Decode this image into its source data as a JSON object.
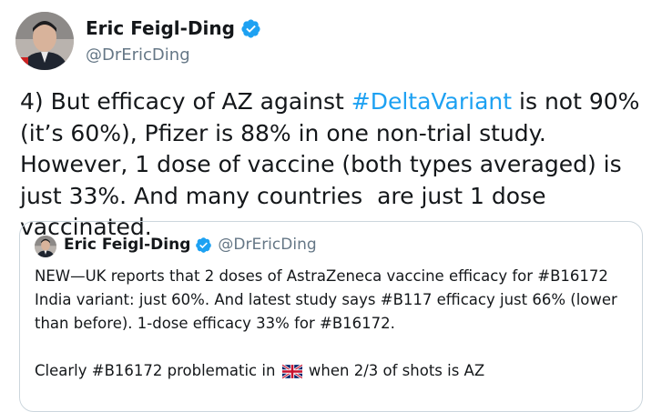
{
  "tweet": {
    "author_name": "Eric Feigl-Ding",
    "author_handle": "@DrEricDing",
    "text_part1": "4) But efficacy of AZ against ",
    "hashtag": "#DeltaVariant",
    "text_part2": " is not 90% (it’s 60%), Pfizer is 88% in one non-trial study. However, 1 dose of vaccine (both types averaged) is just 33%. And many countries  are just 1 dose vaccinated."
  },
  "quote": {
    "author_name": "Eric Feigl-Ding",
    "author_handle": "@DrEricDing",
    "paragraph1": "NEW—UK reports that 2 doses of AstraZeneca vaccine efficacy for #B16172 India variant: just 60%. And latest study says #B117 efficacy just 66% (lower than before). 1-dose efficacy 33% for #B16172.",
    "paragraph2_before_flag": "Clearly #B16172 problematic in ",
    "flag_icon": "uk-flag-icon",
    "paragraph2_after_flag": " when 2/3 of shots is AZ"
  },
  "colors": {
    "hashtag": "#1da1f2",
    "verified": "#1da1f2",
    "secondary_text": "#657786",
    "border": "#ccd6dd"
  }
}
